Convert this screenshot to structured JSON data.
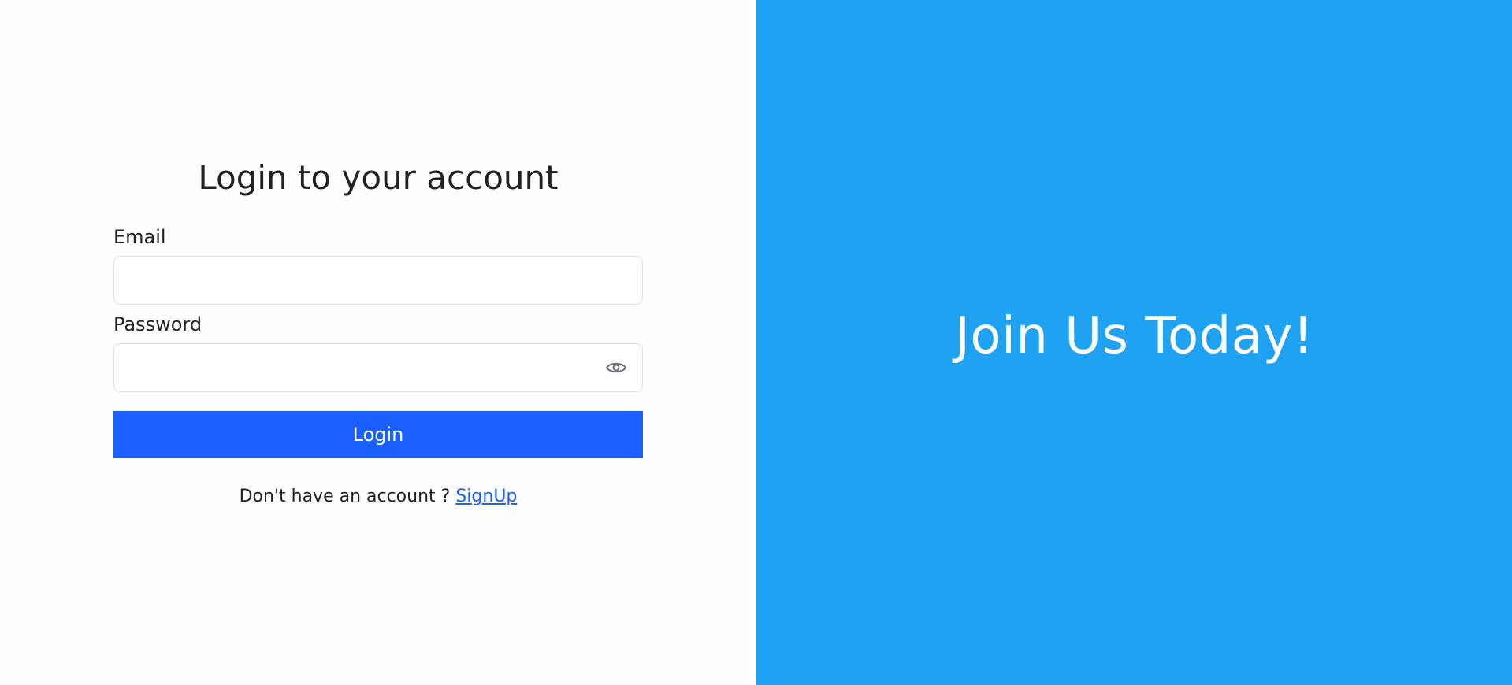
{
  "login_form": {
    "title": "Login to your account",
    "email_label": "Email",
    "email_value": "",
    "password_label": "Password",
    "password_value": "",
    "password_toggle_icon": "eye-icon",
    "login_button_label": "Login",
    "signup_prompt": "Don't have an account ?",
    "signup_link_label": "SignUp"
  },
  "hero": {
    "text": "Join Us Today!"
  },
  "colors": {
    "hero_background": "#1fa2f2",
    "primary_button": "#1a5fff",
    "link": "#1a5fff",
    "text": "#222222",
    "input_border": "#dedfe3"
  }
}
